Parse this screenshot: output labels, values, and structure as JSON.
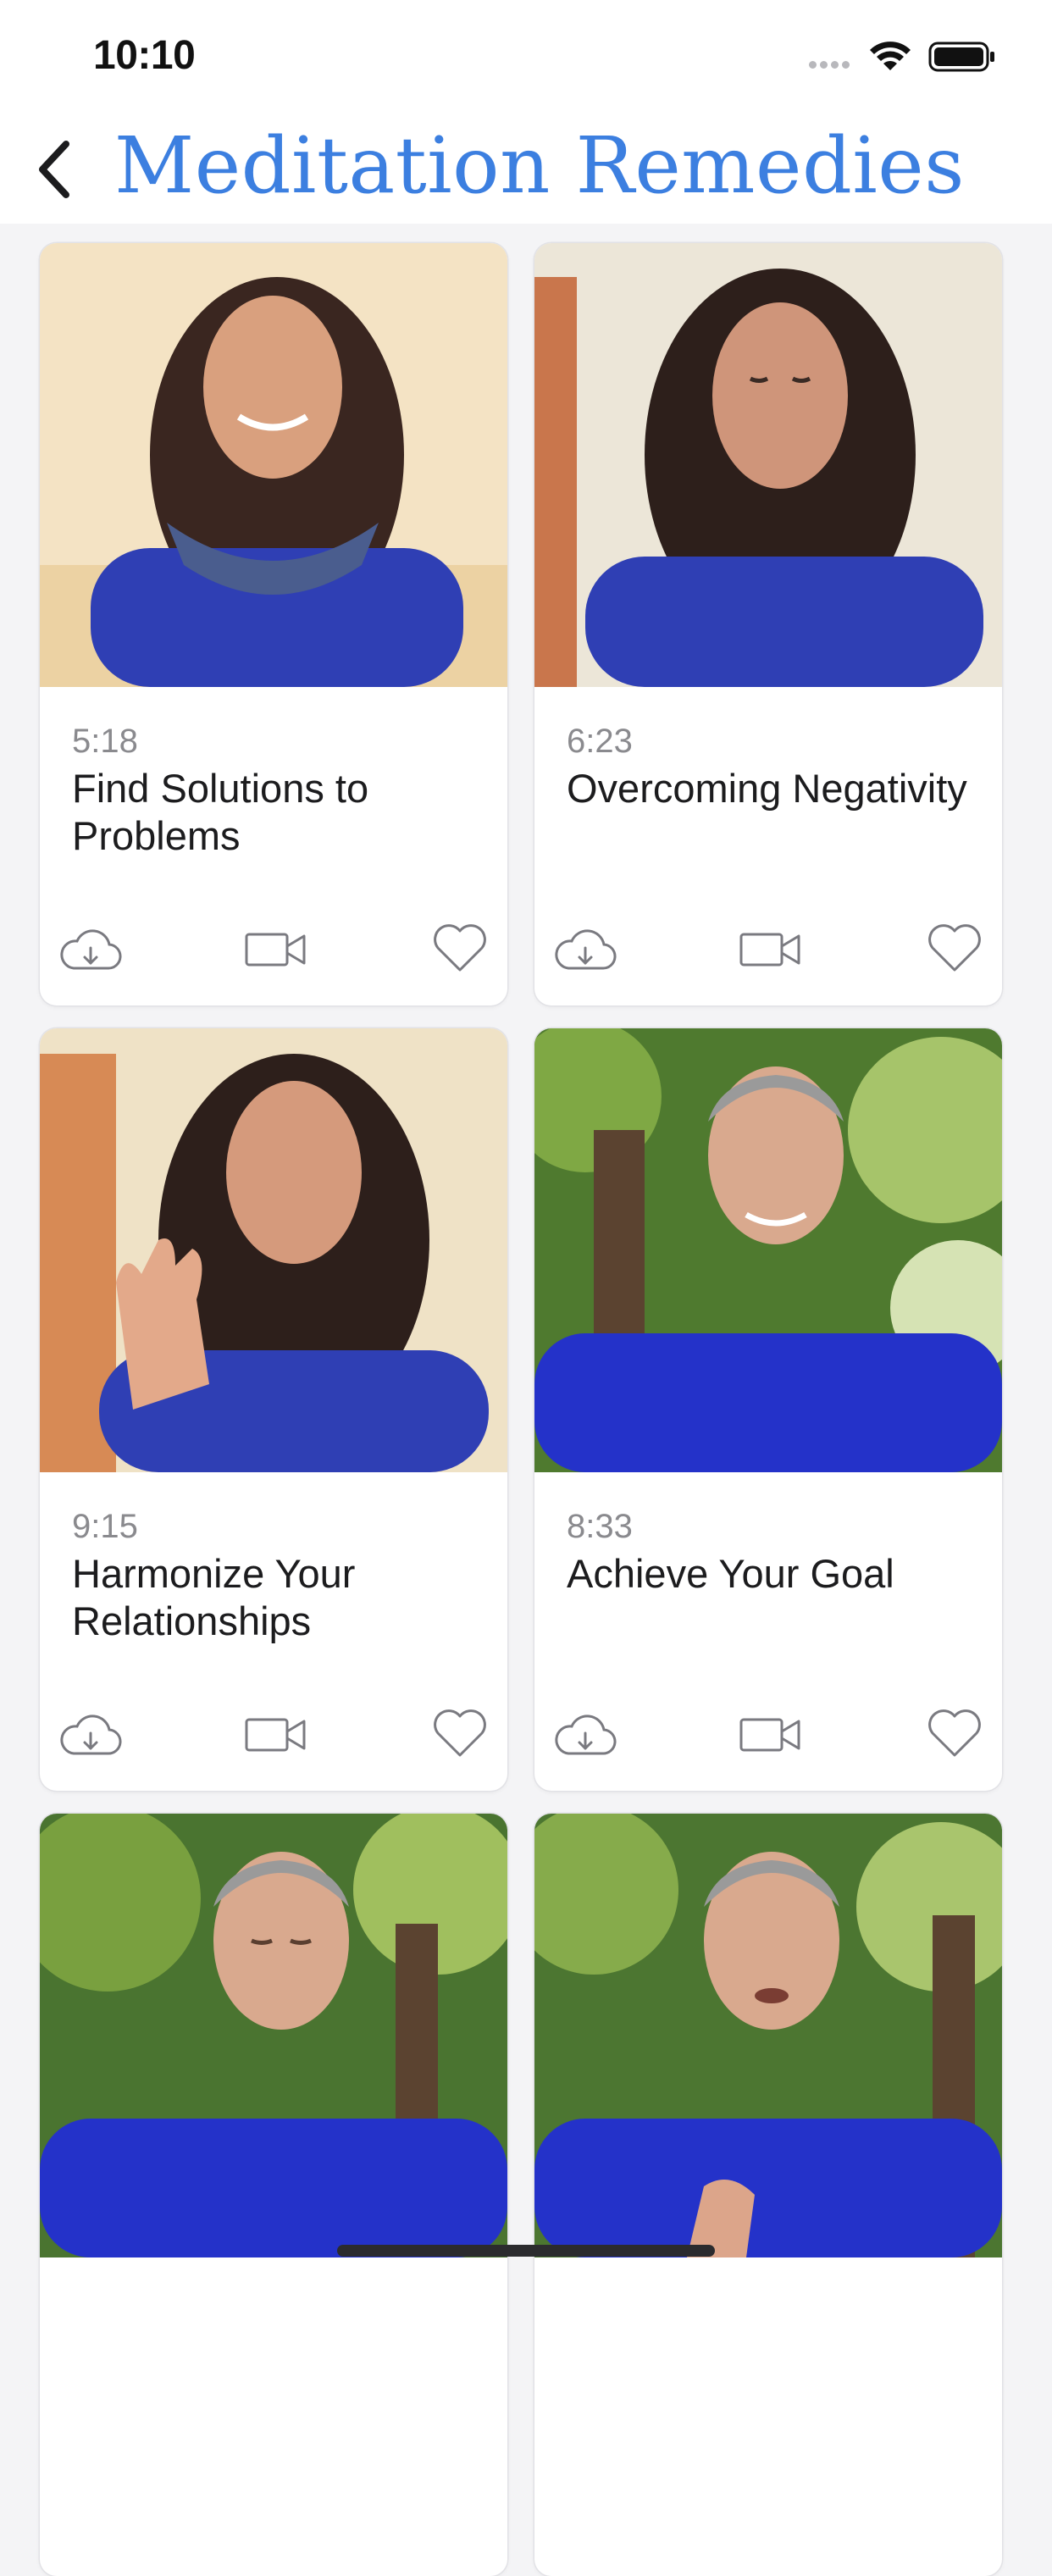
{
  "status_bar": {
    "time": "10:10",
    "icons": [
      "cellular-signal-icon",
      "wifi-icon",
      "battery-icon"
    ]
  },
  "nav": {
    "back_icon": "chevron-left-icon",
    "title": "Meditation Remedies",
    "title_color": "#3c7fe0"
  },
  "videos": [
    {
      "duration": "5:18",
      "title": "Find Solutions to Problems",
      "thumbnail": "woman-smiling-blue-top-scarf"
    },
    {
      "duration": "6:23",
      "title": "Overcoming Negativity",
      "thumbnail": "woman-eyes-closed-blue-shawl"
    },
    {
      "duration": "9:15",
      "title": "Harmonize Your Relationships",
      "thumbnail": "woman-eyes-closed-raised-hand"
    },
    {
      "duration": "8:33",
      "title": "Achieve Your Goal",
      "thumbnail": "man-smiling-blue-shirt-trees"
    },
    {
      "duration": "",
      "title": "",
      "thumbnail": "man-eyes-closed-blue-shirt-trees"
    },
    {
      "duration": "",
      "title": "",
      "thumbnail": "man-speaking-blue-shirt-trees"
    }
  ],
  "card_actions": [
    "cloud-download-icon",
    "video-camera-icon",
    "heart-icon"
  ]
}
